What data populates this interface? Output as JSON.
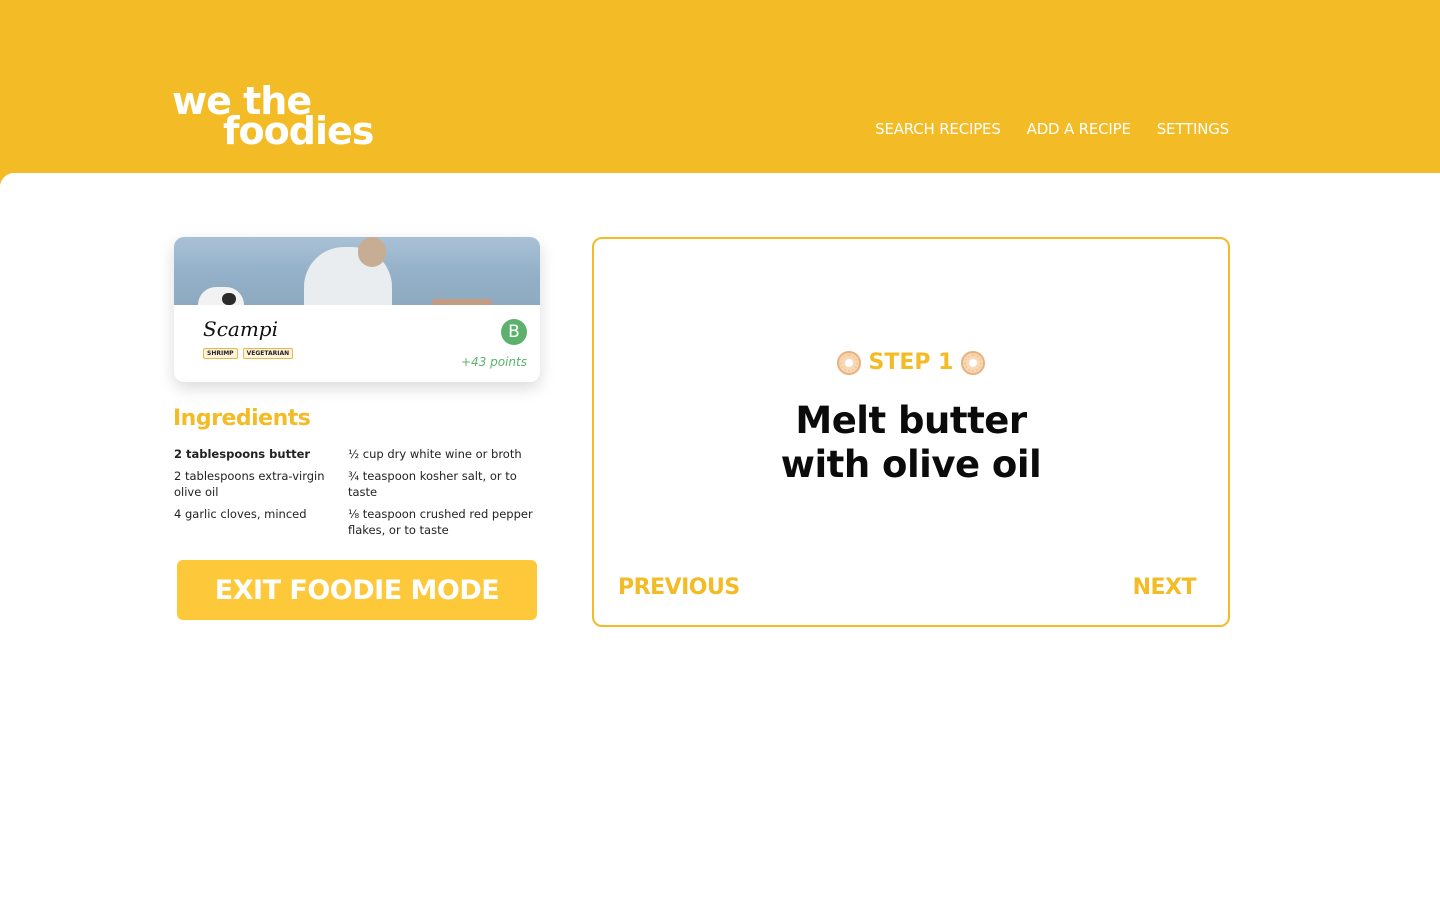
{
  "brand": {
    "logo_line1": "we the",
    "logo_line2": "foodies",
    "accent_color": "#f3bb26",
    "grade_color": "#5cb26c"
  },
  "nav": {
    "items": [
      {
        "label": "SEARCH RECIPES"
      },
      {
        "label": "ADD A RECIPE"
      },
      {
        "label": "SETTINGS"
      }
    ]
  },
  "recipe": {
    "title": "Scampi",
    "tags": [
      "SHRIMP",
      "VEGETARIAN"
    ],
    "grade": "B",
    "points": "+43 points"
  },
  "ingredients": {
    "title": "Ingredients",
    "column1": [
      "2 tablespoons butter",
      "2 tablespoons extra-virgin olive oil",
      "4 garlic cloves, minced"
    ],
    "column2": [
      "½ cup dry white wine or broth",
      "¾ teaspoon kosher salt, or to taste",
      "⅛ teaspoon crushed red pepper flakes, or to taste"
    ]
  },
  "exit_button": "EXIT FOODIE MODE",
  "step": {
    "label": "STEP 1",
    "icon": "donut-icon",
    "text_line1": "Melt butter",
    "text_line2": "with olive oil",
    "previous": "PREVIOUS",
    "next": "NEXT"
  }
}
